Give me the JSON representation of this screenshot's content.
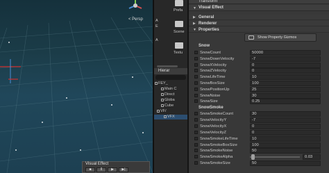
{
  "scene": {
    "persp_label": "< Persp",
    "overlay_title": "Visual Effect",
    "overlay_buttons": [
      "■",
      "II",
      "▶",
      "▶|"
    ]
  },
  "project": {
    "folders": [
      "Prefa",
      "Scene",
      "Textu"
    ],
    "side_letters": [
      "A",
      "E",
      "A"
    ]
  },
  "hierarchy": {
    "title": "Hierar",
    "items": [
      "FEY_",
      "Main C",
      "Direct",
      "Globa",
      "Cube",
      "VF/",
      "VFX"
    ]
  },
  "inspector": {
    "transform_label": "Transform",
    "component_title": "Visual Effect",
    "sections": [
      "General",
      "Renderer",
      "Properties"
    ],
    "gizmo_button": "Show Property Gizmos",
    "snow_group": "Snow",
    "snow_props": [
      {
        "label": "SnowCount",
        "value": "50000"
      },
      {
        "label": "SnowDownVelocity",
        "value": "-7"
      },
      {
        "label": "SnowXVelocity",
        "value": "0"
      },
      {
        "label": "SnowZVelocity",
        "value": "0"
      },
      {
        "label": "SnowLifeTime",
        "value": "10"
      },
      {
        "label": "SnowBoxSize",
        "value": "100"
      },
      {
        "label": "SnowPositionUp",
        "value": "25"
      },
      {
        "label": "SnowNoise",
        "value": "30"
      },
      {
        "label": "SnowSize",
        "value": "0.25"
      }
    ],
    "smoke_group": "SnowSmoke",
    "smoke_props": [
      {
        "label": "SnowSmokeCount",
        "value": "30"
      },
      {
        "label": "SnowVelocityY",
        "value": "-7"
      },
      {
        "label": "SnowVelocityX",
        "value": "0"
      },
      {
        "label": "SnowVelocityZ",
        "value": "0"
      },
      {
        "label": "SnowSmokeLifeTime",
        "value": "10"
      },
      {
        "label": "SnowSmokeBoxSize",
        "value": "100"
      },
      {
        "label": "SnowSmokeNoise",
        "value": "50"
      },
      {
        "label": "SnowSmokeAlpha",
        "value": "0.03",
        "slider": true,
        "fraction": 0.03
      },
      {
        "label": "SnowSmokeSize",
        "value": "50"
      }
    ]
  },
  "colors": {
    "selection": "#2c4e70",
    "inspector_bg": "#383838",
    "scene_sky": "#1b3c48"
  }
}
